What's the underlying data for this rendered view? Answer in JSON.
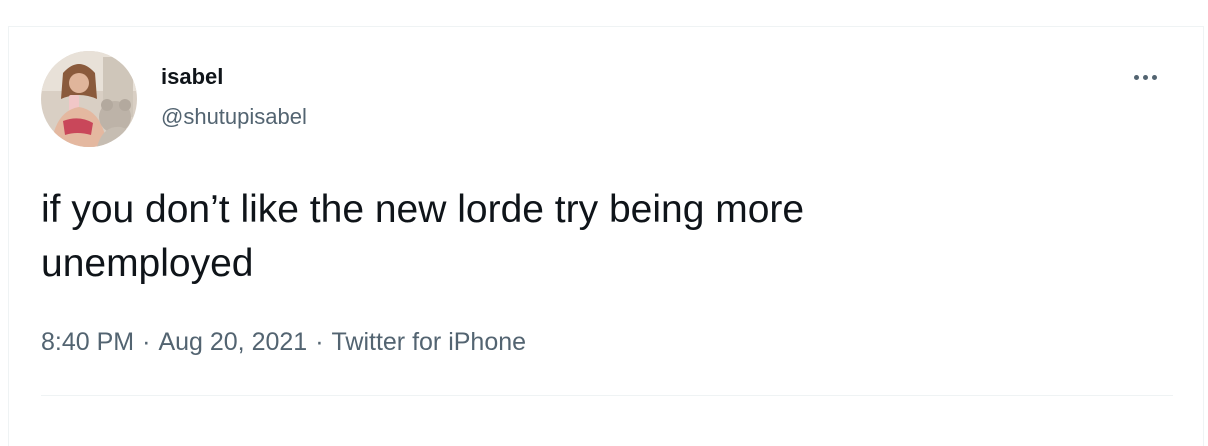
{
  "tweet": {
    "author": {
      "display_name": "isabel",
      "handle": "@shutupisabel",
      "avatar_icon": "profile-photo"
    },
    "text_line1": "if you don’t like the new lorde try being more",
    "text_line2": "unemployed",
    "meta": {
      "time": "8:40 PM",
      "separator": "·",
      "date": "Aug 20, 2021",
      "source": "Twitter for iPhone"
    },
    "more_icon": "more-horizontal-icon"
  },
  "colors": {
    "text_primary": "#0f1419",
    "text_secondary": "#536471",
    "border": "#eff3f4"
  }
}
